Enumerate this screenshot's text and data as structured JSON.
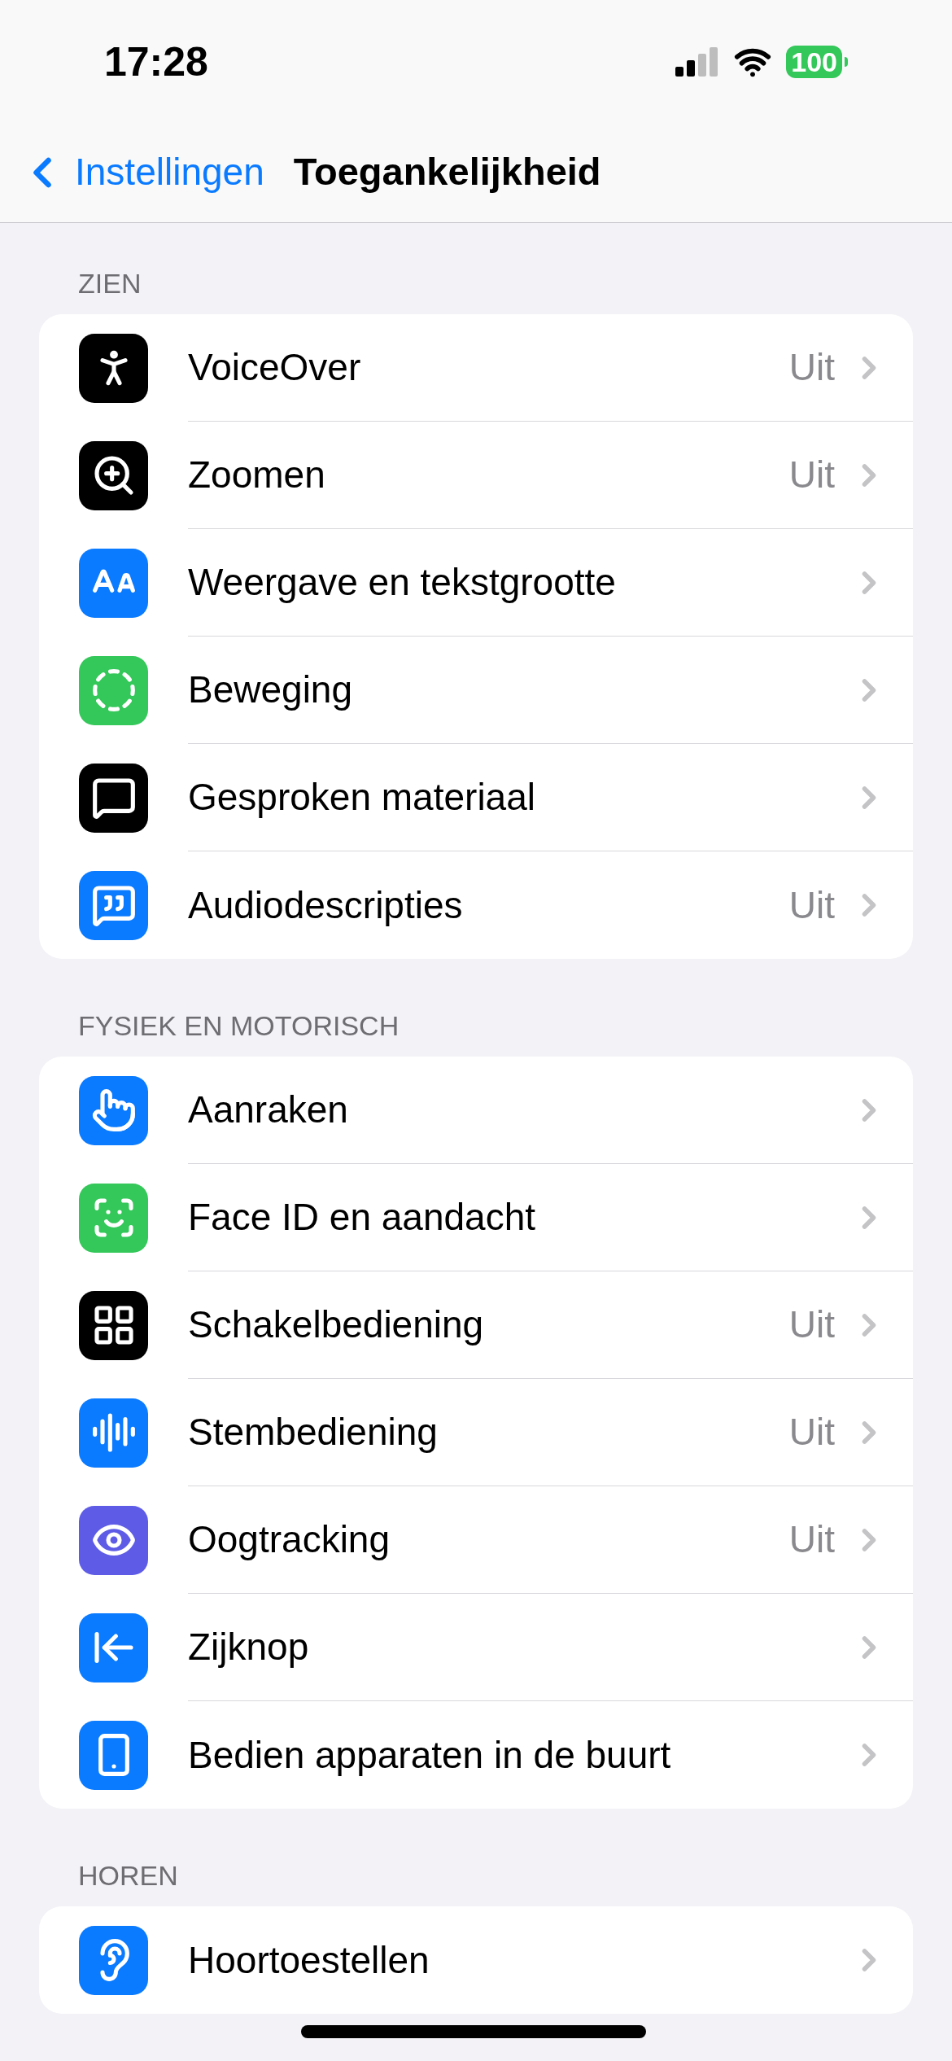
{
  "status_bar": {
    "time": "17:28",
    "battery": "100"
  },
  "nav": {
    "back": "Instellingen",
    "title": "Toegankelijkheid"
  },
  "sections": [
    {
      "header": "ZIEN",
      "rows": [
        {
          "label": "VoiceOver",
          "value": "Uit",
          "color": "#000000"
        },
        {
          "label": "Zoomen",
          "value": "Uit",
          "color": "#000000"
        },
        {
          "label": "Weergave en tekstgrootte",
          "color": "#0a7aff"
        },
        {
          "label": "Beweging",
          "color": "#34c759"
        },
        {
          "label": "Gesproken materiaal",
          "color": "#000000"
        },
        {
          "label": "Audiodescripties",
          "value": "Uit",
          "color": "#0a7aff"
        }
      ]
    },
    {
      "header": "FYSIEK EN MOTORISCH",
      "rows": [
        {
          "label": "Aanraken",
          "color": "#0a7aff"
        },
        {
          "label": "Face ID en aandacht",
          "color": "#34c759"
        },
        {
          "label": "Schakelbediening",
          "value": "Uit",
          "color": "#000000"
        },
        {
          "label": "Stembediening",
          "value": "Uit",
          "color": "#0a7aff"
        },
        {
          "label": "Oogtracking",
          "value": "Uit",
          "color": "#5e5ce6"
        },
        {
          "label": "Zijknop",
          "color": "#0a7aff"
        },
        {
          "label": "Bedien apparaten in de buurt",
          "color": "#0a7aff"
        }
      ]
    },
    {
      "header": "HOREN",
      "rows": [
        {
          "label": "Hoortoestellen",
          "color": "#0a7aff"
        }
      ]
    }
  ]
}
